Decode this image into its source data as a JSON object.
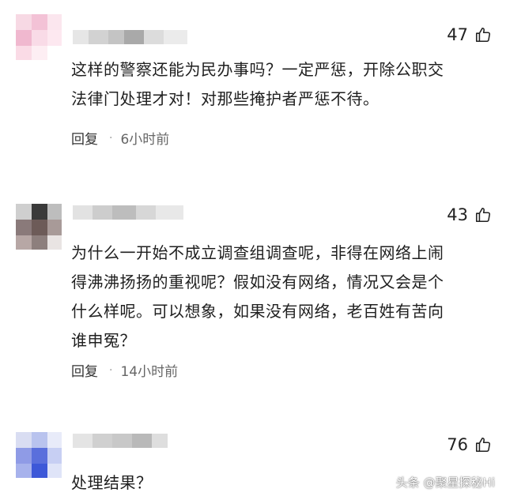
{
  "comments": [
    {
      "likes": "47",
      "text_lines": [
        "这样的警察还能为民办事吗？一定严惩，开除公职交",
        "法律门处理才对！对那些掩护者严惩不待。"
      ],
      "reply_label": "回复",
      "separator": "·",
      "time": "6小时前"
    },
    {
      "likes": "43",
      "text_lines": [
        "为什么一开始不成立调查组调查呢，非得在网络上闹",
        "得沸沸扬扬的重视呢？假如没有网络，情况又会是个",
        "什么样呢。可以想象，如果没有网络，老百姓有苦向",
        "谁申冤？"
      ],
      "reply_label": "回复",
      "separator": "·",
      "time": "14小时前"
    },
    {
      "likes": "76",
      "text_lines": [
        "处理结果？"
      ]
    }
  ],
  "watermark": "头条 @聚星探秘Hi",
  "icons": {
    "like": "thumbs-up-icon"
  }
}
